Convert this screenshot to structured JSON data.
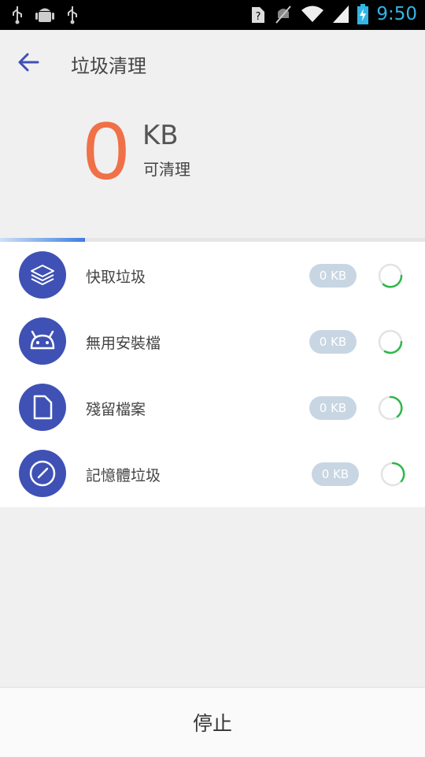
{
  "status_bar": {
    "time": "9:50"
  },
  "app_bar": {
    "title": "垃圾清理"
  },
  "summary": {
    "size": "0",
    "unit": "KB",
    "caption": "可清理"
  },
  "scan_progress": 0.2,
  "items": [
    {
      "label": "快取垃圾",
      "size": "0 KB",
      "icon": "layers-icon"
    },
    {
      "label": "無用安裝檔",
      "size": "0 KB",
      "icon": "android-icon"
    },
    {
      "label": "殘留檔案",
      "size": "0 KB",
      "icon": "file-icon"
    },
    {
      "label": "記憶體垃圾",
      "size": "0 KB",
      "icon": "speedometer-icon"
    }
  ],
  "bottom": {
    "stop_label": "停止"
  },
  "colors": {
    "accent": "#3f51b5",
    "number": "#f07048",
    "spinner": "#2db84a",
    "time": "#33b5e5"
  }
}
